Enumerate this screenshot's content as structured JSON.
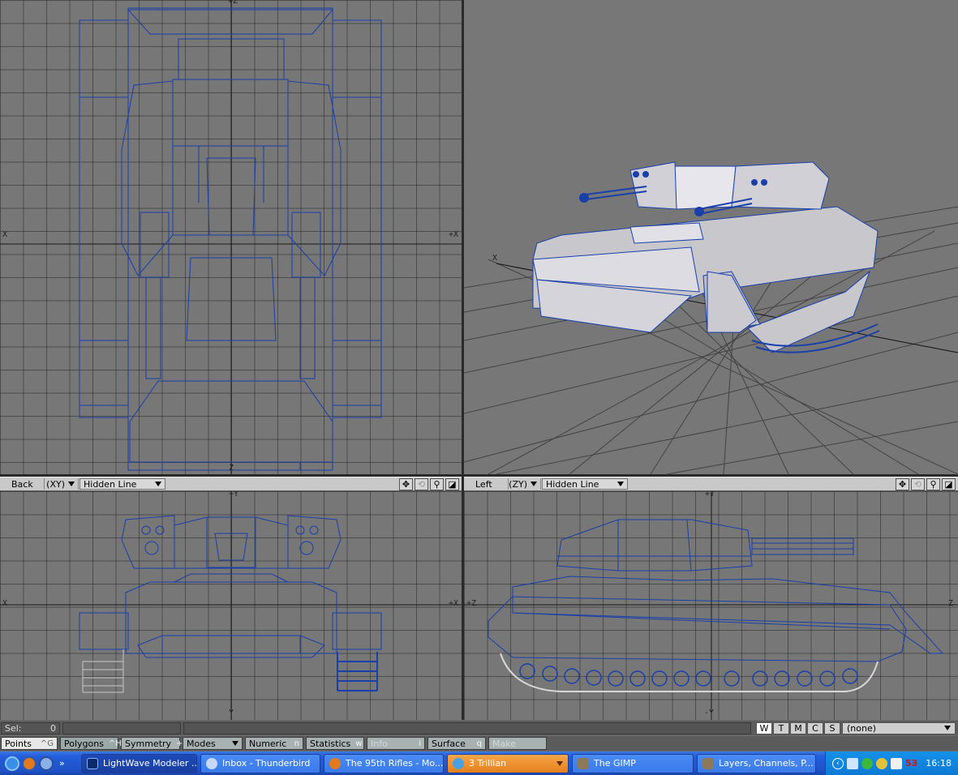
{
  "viewports": {
    "top": {
      "axis_left": "X",
      "axis_right": "+X",
      "axis_top": "+Z",
      "axis_bottom": "Z"
    },
    "perspective": {
      "axis_label": "X"
    },
    "back": {
      "view_name": "Back",
      "projection": "(XY)",
      "render_mode": "Hidden Line",
      "axis_left": "X",
      "axis_right": "+X",
      "axis_top": "+Y",
      "axis_bottom": "Y"
    },
    "left": {
      "view_name": "Left",
      "projection": "(ZY)",
      "render_mode": "Hidden Line",
      "axis_left": "+Z",
      "axis_right": "Z",
      "axis_top": "+Y",
      "axis_bottom": "-Y"
    },
    "header_icons": [
      "move-view-icon",
      "rotate-view-icon",
      "zoom-icon",
      "maximize-icon"
    ]
  },
  "status_bar": {
    "sel_label": "Sel:",
    "sel_value": "0",
    "view_buttons": [
      "W",
      "T",
      "M",
      "C",
      "S"
    ],
    "active_view_button": "W",
    "surface_select": "(none)"
  },
  "tool_bar": {
    "items": [
      {
        "label": "Points",
        "shortcut": "^G"
      },
      {
        "label": "Polygons",
        "shortcut": "^H"
      },
      {
        "label": "Symmetry",
        "shortcut": "+Y"
      },
      {
        "label": "Modes",
        "shortcut": ""
      },
      {
        "label": "Numeric",
        "shortcut": "n"
      },
      {
        "label": "Statistics",
        "shortcut": "w"
      },
      {
        "label": "Info",
        "shortcut": "i"
      },
      {
        "label": "Surface",
        "shortcut": "q"
      },
      {
        "label": "Make",
        "shortcut": ""
      }
    ]
  },
  "taskbar": {
    "windows": [
      {
        "label": "LightWave Modeler ...",
        "icon": "lightwave-icon",
        "active": true
      },
      {
        "label": "Inbox - Thunderbird",
        "icon": "thunderbird-icon",
        "active": false
      },
      {
        "label": "The 95th Rifles - Mo...",
        "icon": "firefox-icon",
        "active": false
      },
      {
        "label": "3 Trillian",
        "icon": "trillian-icon",
        "active": false
      },
      {
        "label": "The GIMP",
        "icon": "gimp-icon",
        "active": false
      },
      {
        "label": "Layers, Channels, P...",
        "icon": "gimp-icon",
        "active": false
      }
    ],
    "tray_number": "53",
    "clock": "16:18"
  },
  "colors": {
    "wire": "#1a3fa8",
    "viewport_bg": "#777777",
    "grid": "#3a3a3a",
    "taskbar_blue": "#245edb",
    "trillian_orange": "#f0962e",
    "tray_red": "#e01010"
  }
}
